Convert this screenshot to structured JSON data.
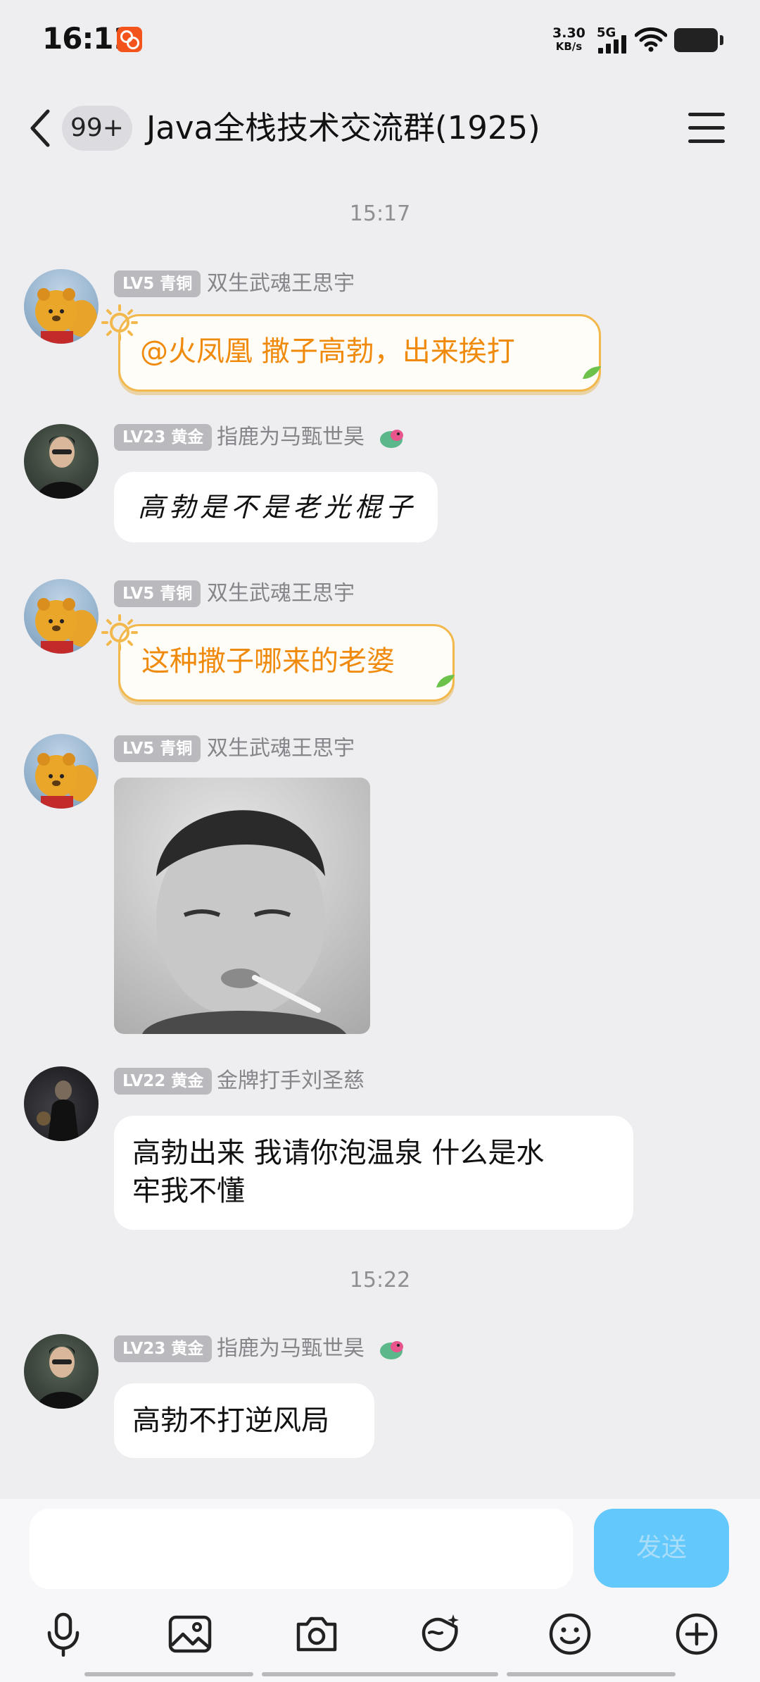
{
  "status_bar": {
    "time": "16:11",
    "net_speed_value": "3.30",
    "net_speed_unit": "KB/s",
    "network": "5G",
    "notification_icon": "app-notification-icon",
    "signal_icon": "signal-icon",
    "wifi_icon": "wifi-icon",
    "battery_icon": "battery-icon"
  },
  "header": {
    "back_icon": "back-icon",
    "unread_badge": "99+",
    "title": "Java全栈技术交流群(1925)",
    "menu_icon": "menu-icon"
  },
  "messages": [
    {
      "kind": "timestamp",
      "text": "15:17"
    },
    {
      "kind": "message",
      "level": "LV5 青铜",
      "sender": "双生武魂王思宇",
      "text": "@火凤凰  撒子高勃，出来挨打",
      "bubble_style": "orange-sun"
    },
    {
      "kind": "message",
      "level": "LV23 黄金",
      "sender": "指鹿为马甄世昊",
      "text": "高勃是不是老光棍子",
      "bubble_style": "handwriting"
    },
    {
      "kind": "message",
      "level": "LV5 青铜",
      "sender": "双生武魂王思宇",
      "text": "这种撒子哪来的老婆",
      "bubble_style": "orange-sun"
    },
    {
      "kind": "message",
      "level": "LV5 青铜",
      "sender": "双生武魂王思宇",
      "bubble_style": "image"
    },
    {
      "kind": "message",
      "level": "LV22 黄金",
      "sender": "金牌打手刘圣慈",
      "text_line1": "高勃出来 我请你泡温泉 什么是水",
      "text_line2": "牢我不懂",
      "bubble_style": "plain"
    },
    {
      "kind": "timestamp",
      "text": "15:22"
    },
    {
      "kind": "message",
      "level": "LV23 黄金",
      "sender": "指鹿为马甄世昊",
      "text": "高勃不打逆风局",
      "bubble_style": "plain"
    }
  ],
  "input": {
    "placeholder": "",
    "send_label": "发送"
  },
  "toolbar": [
    "microphone-icon",
    "photo-icon",
    "camera-icon",
    "red-packet-icon",
    "emoji-icon",
    "plus-icon"
  ],
  "colors": {
    "background": "#EEEEF1",
    "accent_orange": "#F08A0C",
    "send_button": "#63C8FB",
    "level_badge": "#B9B9BE"
  }
}
